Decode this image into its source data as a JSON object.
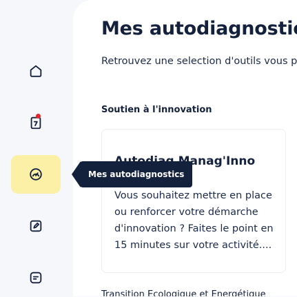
{
  "sidebar": {
    "items": [
      {
        "name": "home",
        "icon": "home-icon",
        "active": false
      },
      {
        "name": "documents",
        "icon": "document-badge-icon",
        "active": false,
        "notification": true
      },
      {
        "name": "autodiagnostics",
        "icon": "gauge-icon",
        "active": true
      },
      {
        "name": "tools",
        "icon": "pen-square-icon",
        "active": false
      },
      {
        "name": "messages",
        "icon": "chat-icon",
        "active": false
      }
    ],
    "active_color": "#fbf0a6",
    "notification_color": "#e3262f"
  },
  "tooltip": {
    "label": "Mes autodiagnostics"
  },
  "main": {
    "title": "Mes autodiagnostics",
    "subtitle": "Retrouvez une selection d'outils vous pe",
    "section": {
      "title": "Soutien à l'innovation",
      "card": {
        "title": "Autodiag Manag'Inno",
        "description": "Vous souhaitez mettre en place ou renforcer votre démarche d'innovation ? Faites le point en 15 minutes sur votre activité...."
      }
    },
    "next_section_title": "Transition Ecologique et Energétique"
  },
  "colors": {
    "navy": "#14213d",
    "background": "#f6f7fa"
  }
}
